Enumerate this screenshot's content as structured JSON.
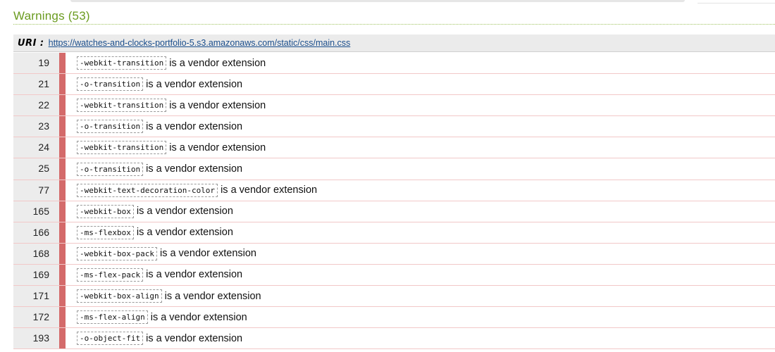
{
  "heading": "Warnings (53)",
  "uri": {
    "label": "URI :",
    "link": "https://watches-and-clocks-portfolio-5.s3.amazonaws.com/static/css/main.css"
  },
  "colors": {
    "heading": "#6a9b1f",
    "marker": "#d46a6a",
    "link": "#1a4e8c"
  },
  "rows": [
    {
      "line": "19",
      "code": "-webkit-transition",
      "message": "is a vendor extension"
    },
    {
      "line": "21",
      "code": "-o-transition",
      "message": "is a vendor extension"
    },
    {
      "line": "22",
      "code": "-webkit-transition",
      "message": "is a vendor extension"
    },
    {
      "line": "23",
      "code": "-o-transition",
      "message": "is a vendor extension"
    },
    {
      "line": "24",
      "code": "-webkit-transition",
      "message": "is a vendor extension"
    },
    {
      "line": "25",
      "code": "-o-transition",
      "message": "is a vendor extension"
    },
    {
      "line": "77",
      "code": "-webkit-text-decoration-color",
      "message": "is a vendor extension"
    },
    {
      "line": "165",
      "code": "-webkit-box",
      "message": "is a vendor extension"
    },
    {
      "line": "166",
      "code": "-ms-flexbox",
      "message": "is a vendor extension"
    },
    {
      "line": "168",
      "code": "-webkit-box-pack",
      "message": "is a vendor extension"
    },
    {
      "line": "169",
      "code": "-ms-flex-pack",
      "message": "is a vendor extension"
    },
    {
      "line": "171",
      "code": "-webkit-box-align",
      "message": "is a vendor extension"
    },
    {
      "line": "172",
      "code": "-ms-flex-align",
      "message": "is a vendor extension"
    },
    {
      "line": "193",
      "code": "-o-object-fit",
      "message": "is a vendor extension"
    }
  ]
}
